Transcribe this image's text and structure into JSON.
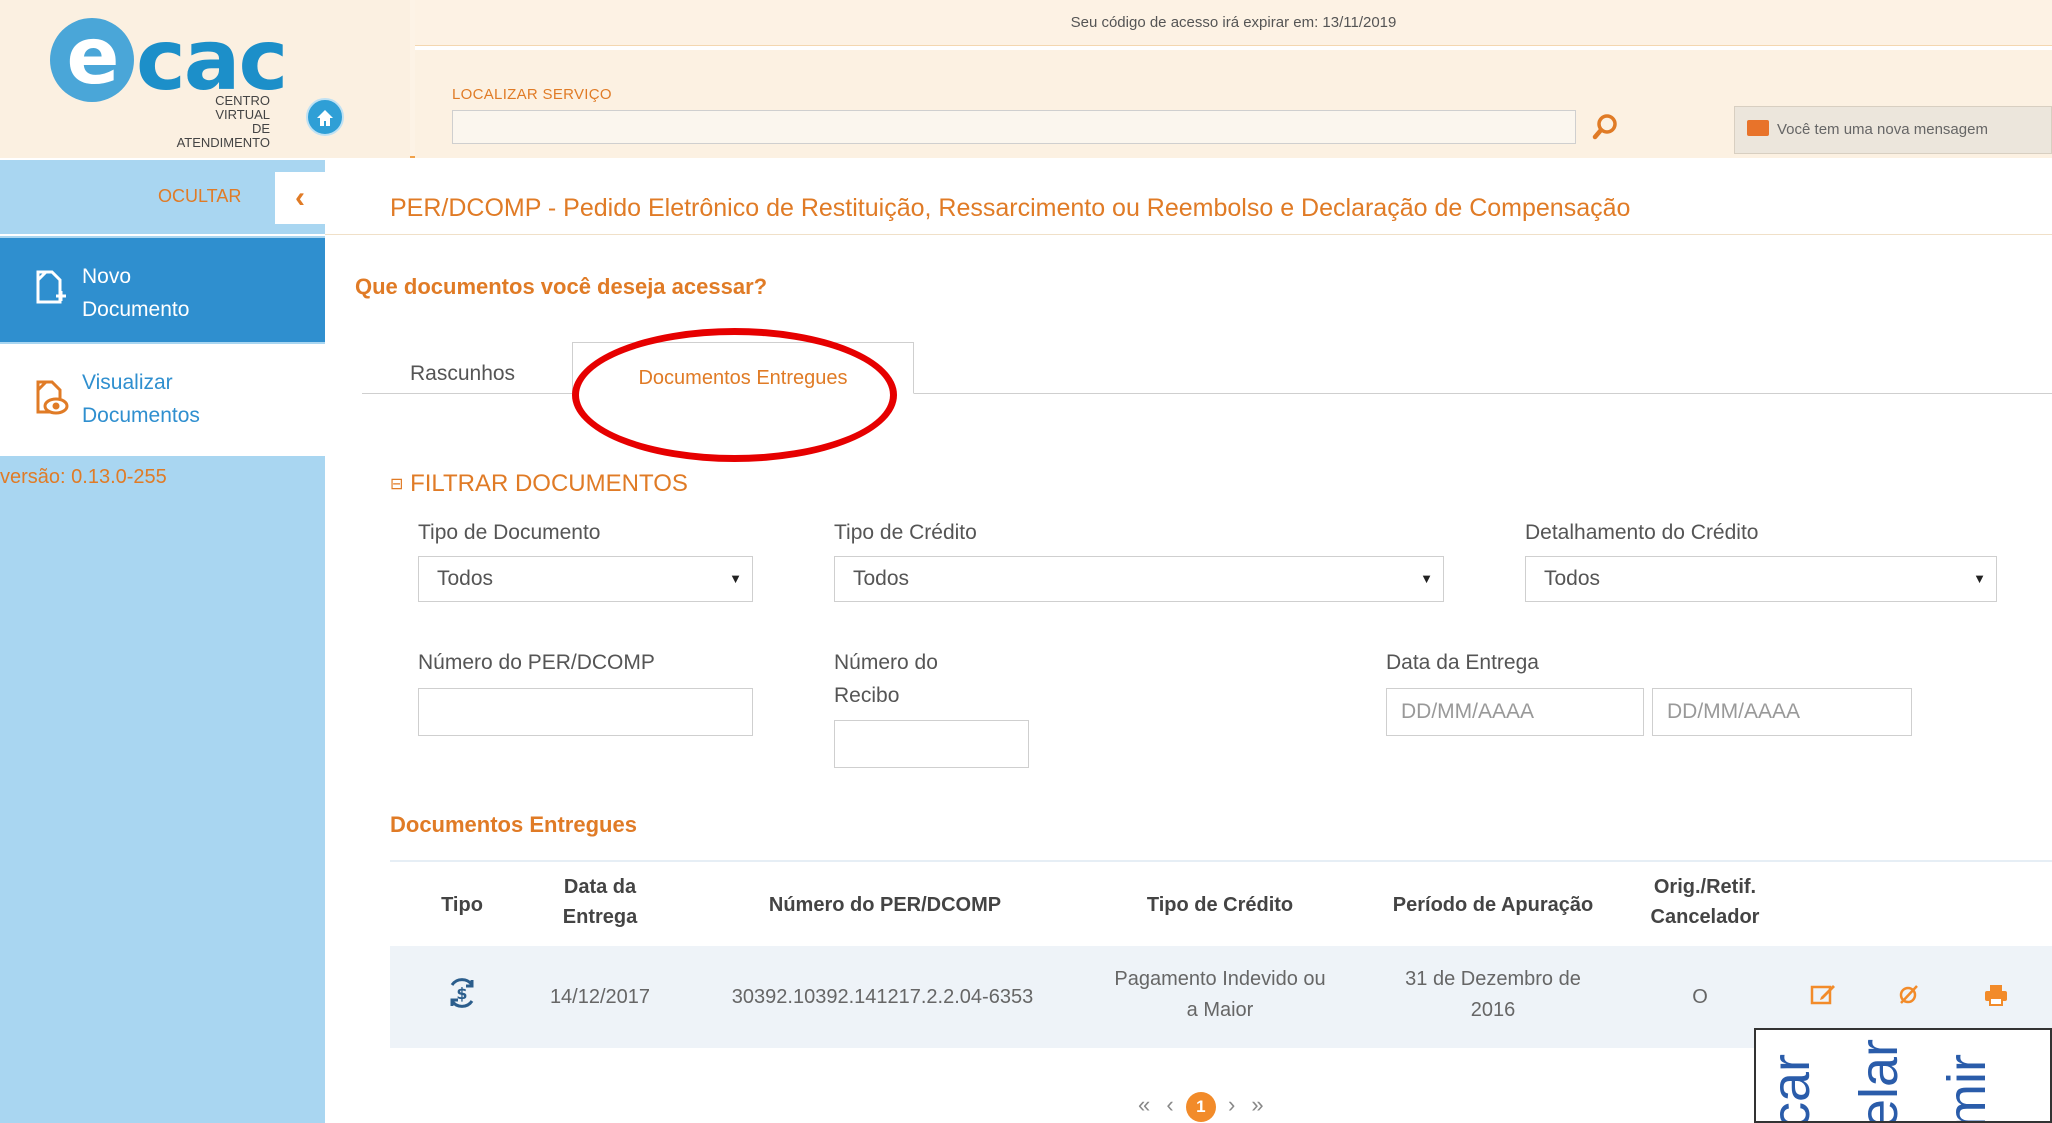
{
  "header": {
    "logo_text": "cac",
    "logo_letter": "e",
    "logo_subtitle_line1": "CENTRO VIRTUAL",
    "logo_subtitle_line2": "DE ATENDIMENTO",
    "expire_notice": "Seu código de acesso irá expirar em: 13/11/2019",
    "search_label": "LOCALIZAR SERVIÇO",
    "search_value": "",
    "message_button": "Você tem uma nova mensagem"
  },
  "sidebar": {
    "hide_label": "OCULTAR",
    "items": [
      {
        "line1": "Novo",
        "line2": "Documento"
      },
      {
        "line1": "Visualizar",
        "line2": "Documentos"
      }
    ],
    "version": "versão: 0.13.0-255"
  },
  "main": {
    "page_title": "PER/DCOMP - Pedido Eletrônico de Restituição, Ressarcimento ou Reembolso e Declaração de Compensação",
    "question": "Que documentos você deseja acessar?",
    "tabs": [
      {
        "label": "Rascunhos"
      },
      {
        "label": "Documentos Entregues"
      }
    ],
    "filter": {
      "title": "FILTRAR DOCUMENTOS",
      "toggle_symbol": "⊟",
      "tipo_documento_label": "Tipo de Documento",
      "tipo_documento_value": "Todos",
      "tipo_credito_label": "Tipo de Crédito",
      "tipo_credito_value": "Todos",
      "detalhamento_label": "Detalhamento do Crédito",
      "detalhamento_value": "Todos",
      "numero_perdcomp_label": "Número do PER/DCOMP",
      "numero_recibo_label_line1": "Número do",
      "numero_recibo_label_line2": "Recibo",
      "data_entrega_label": "Data da Entrega",
      "data_inicio_placeholder": "DD/MM/AAAA",
      "data_fim_placeholder": "DD/MM/AAAA"
    },
    "results": {
      "title": "Documentos Entregues",
      "columns": {
        "tipo": "Tipo",
        "data_line1": "Data da",
        "data_line2": "Entrega",
        "numero": "Número do PER/DCOMP",
        "tipo_credito": "Tipo de Crédito",
        "periodo": "Período de Apuração",
        "orig_line1": "Orig./Retif.",
        "orig_line2": "Cancelador"
      },
      "rows": [
        {
          "tipo_icon": "refund-dollar-icon",
          "data_entrega": "14/12/2017",
          "numero": "30392.10392.141217.2.2.04-6353",
          "tipo_credito_line1": "Pagamento Indevido ou",
          "tipo_credito_line2": "a Maior",
          "periodo_line1": "31 de Dezembro de",
          "periodo_line2": "2016",
          "orig": "O",
          "actions": [
            "edit-icon",
            "cancel-icon",
            "print-icon"
          ]
        }
      ]
    },
    "pagination": {
      "first": "«",
      "prev": "‹",
      "current": "1",
      "next": "›",
      "last": "»"
    },
    "action_legend": [
      "car",
      "elar",
      "mir"
    ]
  },
  "colors": {
    "accent_orange": "#e07b26",
    "sidebar_blue": "#a9d6f1",
    "nav_active_blue": "#2f8fcf",
    "highlight_red": "#e60000"
  }
}
